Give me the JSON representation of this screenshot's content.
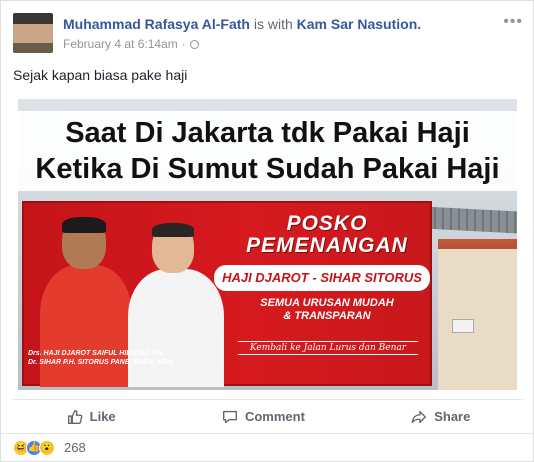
{
  "post": {
    "author": "Muhammad Rafasya Al-Fath",
    "with_text": "is with",
    "tagged": "Kam Sar Nasution.",
    "timestamp": "February 4 at 6:14am",
    "separator": "·",
    "privacy_icon": "globe-icon",
    "status_text": "Sejak kapan biasa pake haji"
  },
  "image": {
    "headline_line1": "Saat Di Jakarta tdk Pakai Haji",
    "headline_line2": "Ketika Di Sumut Sudah Pakai Haji",
    "banner": {
      "posko_line1": "POSKO",
      "posko_line2": "PEMENANGAN",
      "candidate_a": "HAJI DJAROT",
      "candidate_sep": " - ",
      "candidate_b": "SIHAR SITORUS",
      "slogan_line1": "SEMUA URUSAN MUDAH",
      "slogan_line2": "& TRANSPARAN",
      "tagline": "Kembali ke Jalan Lurus dan Benar",
      "name_line1": "Drs. HAJI DJAROT SAIFUL HIDAYAT, MS",
      "name_line2": "Dr. SIHAR P.H. SITORUS PANE, BSBA, MBA"
    }
  },
  "actions": {
    "like_label": "Like",
    "comment_label": "Comment",
    "share_label": "Share"
  },
  "reactions": {
    "types": [
      "haha-icon",
      "like-icon",
      "wow-icon"
    ],
    "count": "268"
  },
  "colors": {
    "link_blue": "#365899",
    "banner_red": "#c41419",
    "muted_gray": "#616770"
  }
}
